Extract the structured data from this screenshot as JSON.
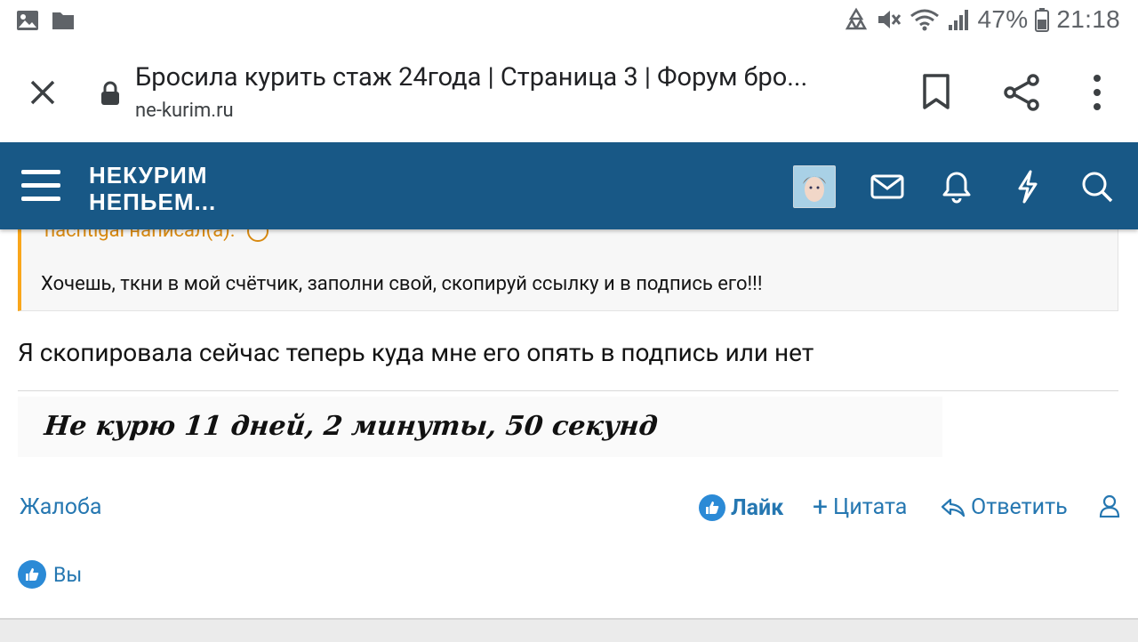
{
  "status_bar": {
    "battery_pct": "47%",
    "time": "21:18",
    "icons": [
      "gallery-icon",
      "folder-icon",
      "recycle-icon",
      "mute-icon",
      "wifi-icon",
      "signal-icon",
      "battery-icon"
    ]
  },
  "browser": {
    "page_title": "Бросила курить стаж 24года | Страница 3 | Форум бро...",
    "url": "ne-kurim.ru"
  },
  "site_header": {
    "logo_line1": "НЕКУРИМ",
    "logo_line2": "НЕПЬЕМ...",
    "brand_color": "#185886"
  },
  "quote": {
    "author": "nachtigal написал(а):",
    "text": "Хочешь, ткни в мой счётчик, заполни свой, скопируй ссылку и в подпись его!!!"
  },
  "post": {
    "text": "Я скопировала сейчас теперь куда мне его опять в подпись или нет",
    "signature": "Не курю 11 дней, 2 минуты, 50 секунд"
  },
  "actions": {
    "report": "Жалоба",
    "like": "Лайк",
    "quote": "Цитата",
    "reply": "Ответить"
  },
  "likes": {
    "text": "Вы"
  },
  "colors": {
    "link": "#2577b1",
    "quote_accent": "#f9a61b"
  }
}
